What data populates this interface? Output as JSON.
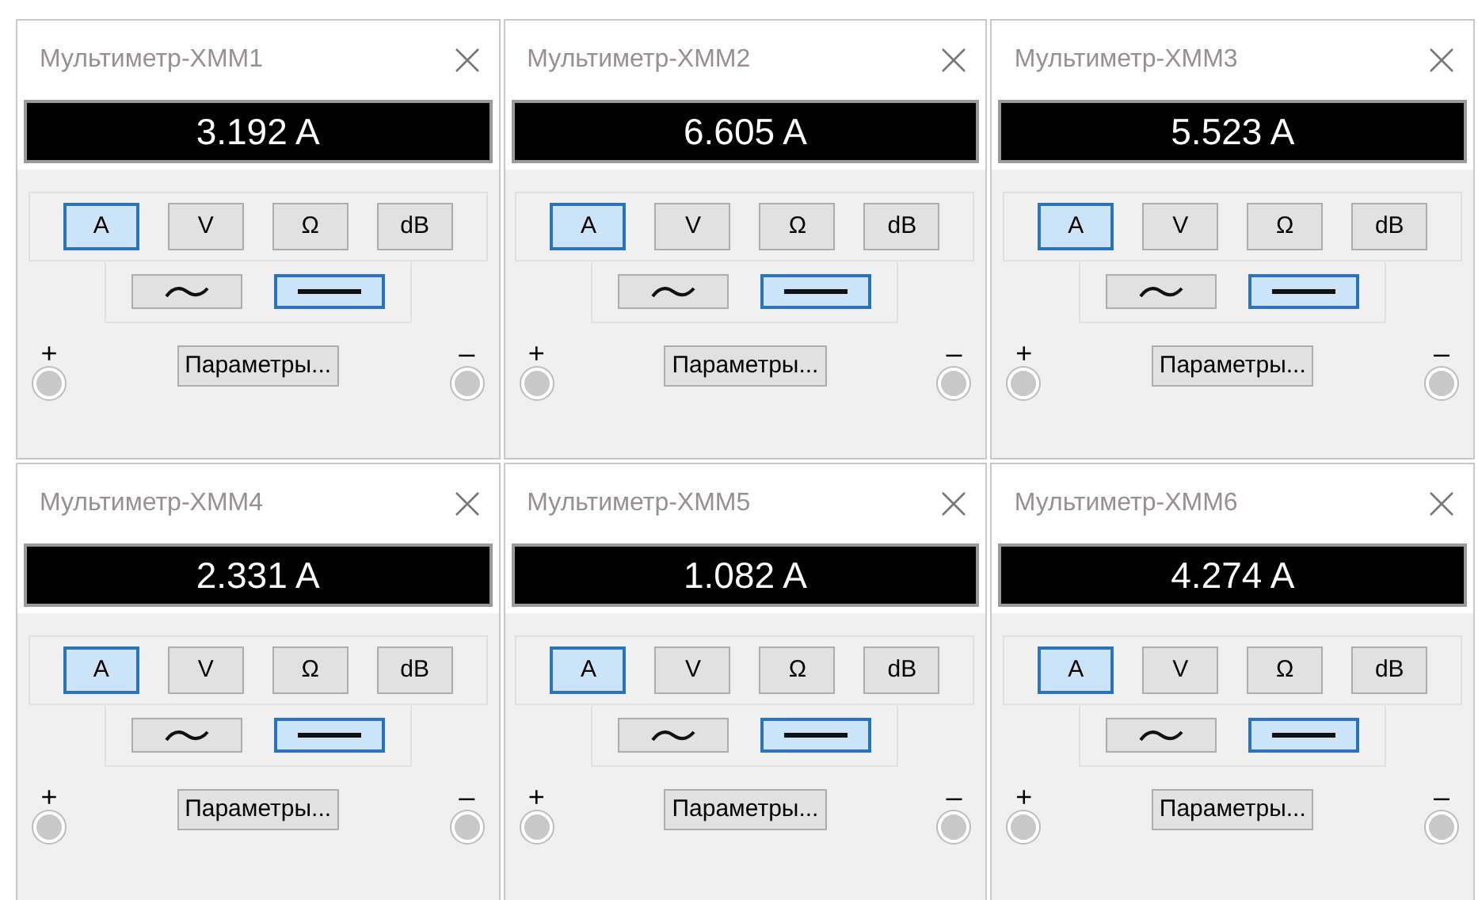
{
  "meters": [
    {
      "title": "Мультиметр-XMM1",
      "reading": "3.192 A",
      "modes": [
        {
          "label": "A",
          "selected": true
        },
        {
          "label": "V",
          "selected": false
        },
        {
          "label": "Ω",
          "selected": false
        },
        {
          "label": "dB",
          "selected": false
        }
      ],
      "signals": [
        {
          "kind": "ac",
          "selected": false
        },
        {
          "kind": "dc",
          "selected": true
        }
      ],
      "plus": "+",
      "minus": "–",
      "settings": "Параметры..."
    },
    {
      "title": "Мультиметр-XMM2",
      "reading": "6.605 A",
      "modes": [
        {
          "label": "A",
          "selected": true
        },
        {
          "label": "V",
          "selected": false
        },
        {
          "label": "Ω",
          "selected": false
        },
        {
          "label": "dB",
          "selected": false
        }
      ],
      "signals": [
        {
          "kind": "ac",
          "selected": false
        },
        {
          "kind": "dc",
          "selected": true
        }
      ],
      "plus": "+",
      "minus": "–",
      "settings": "Параметры..."
    },
    {
      "title": "Мультиметр-XMM3",
      "reading": "5.523 A",
      "modes": [
        {
          "label": "A",
          "selected": true
        },
        {
          "label": "V",
          "selected": false
        },
        {
          "label": "Ω",
          "selected": false
        },
        {
          "label": "dB",
          "selected": false
        }
      ],
      "signals": [
        {
          "kind": "ac",
          "selected": false
        },
        {
          "kind": "dc",
          "selected": true
        }
      ],
      "plus": "+",
      "minus": "–",
      "settings": "Параметры..."
    },
    {
      "title": "Мультиметр-XMM4",
      "reading": "2.331 A",
      "modes": [
        {
          "label": "A",
          "selected": true
        },
        {
          "label": "V",
          "selected": false
        },
        {
          "label": "Ω",
          "selected": false
        },
        {
          "label": "dB",
          "selected": false
        }
      ],
      "signals": [
        {
          "kind": "ac",
          "selected": false
        },
        {
          "kind": "dc",
          "selected": true
        }
      ],
      "plus": "+",
      "minus": "–",
      "settings": "Параметры..."
    },
    {
      "title": "Мультиметр-XMM5",
      "reading": "1.082 A",
      "modes": [
        {
          "label": "A",
          "selected": true
        },
        {
          "label": "V",
          "selected": false
        },
        {
          "label": "Ω",
          "selected": false
        },
        {
          "label": "dB",
          "selected": false
        }
      ],
      "signals": [
        {
          "kind": "ac",
          "selected": false
        },
        {
          "kind": "dc",
          "selected": true
        }
      ],
      "plus": "+",
      "minus": "–",
      "settings": "Параметры..."
    },
    {
      "title": "Мультиметр-XMM6",
      "reading": "4.274 A",
      "modes": [
        {
          "label": "A",
          "selected": true
        },
        {
          "label": "V",
          "selected": false
        },
        {
          "label": "Ω",
          "selected": false
        },
        {
          "label": "dB",
          "selected": false
        }
      ],
      "signals": [
        {
          "kind": "ac",
          "selected": false
        },
        {
          "kind": "dc",
          "selected": true
        }
      ],
      "plus": "+",
      "minus": "–",
      "settings": "Параметры..."
    }
  ]
}
